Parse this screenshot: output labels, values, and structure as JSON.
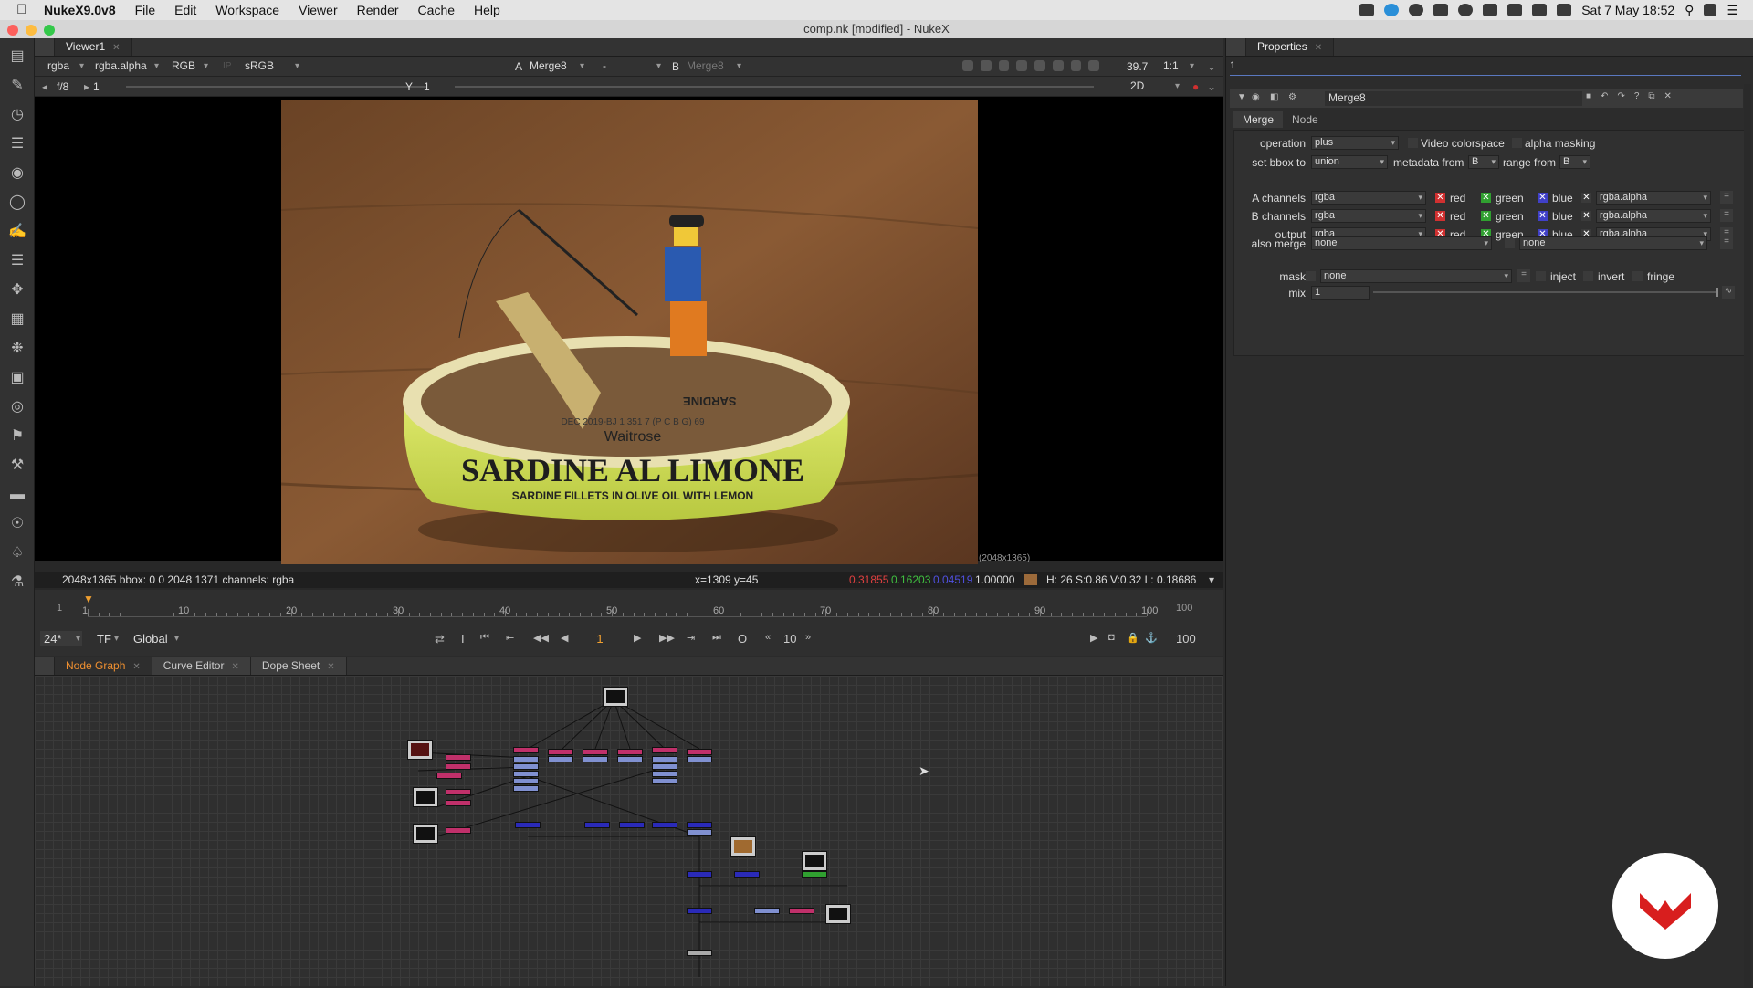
{
  "menubar": {
    "app": "NukeX9.0v8",
    "items": [
      "File",
      "Edit",
      "Workspace",
      "Viewer",
      "Render",
      "Cache",
      "Help"
    ],
    "clock": "Sat 7 May  18:52"
  },
  "window": {
    "title": "comp.nk [modified] - NukeX"
  },
  "viewer": {
    "tab": "Viewer1",
    "controls": {
      "channels": "rgba",
      "alpha": "rgba.alpha",
      "display": "RGB",
      "ip": "IP",
      "lut": "sRGB",
      "a_label": "A",
      "a_input": "Merge8",
      "a_op": "-",
      "b_label": "B",
      "b_input": "Merge8",
      "zoom": "39.7",
      "ratio": "1:1",
      "fstop": "f/8",
      "frame_field": "1",
      "y_label": "Y",
      "y_field": "1",
      "mode": "2D"
    },
    "image": {
      "top_text": "DEC 2019-BJ 1 351 7 (P C B G) 69",
      "brand": "Waitrose",
      "main": "SARDINE AL LIMONE",
      "sub": "SARDINE FILLETS IN OLIVE OIL WITH LEMON",
      "lid_text": "SARDINE",
      "format_label": "(2048x1365)"
    },
    "info": {
      "resolution": "2048x1365  bbox: 0 0 2048 1371 channels: rgba",
      "coords": "x=1309 y=45",
      "r": "0.31855",
      "g": "0.16203",
      "b": "0.04519",
      "a": "1.00000",
      "hsv": "H: 26 S:0.86 V:0.32  L: 0.18686"
    },
    "timeline": {
      "start": "1",
      "ticks": [
        "1",
        "10",
        "20",
        "30",
        "40",
        "50",
        "60",
        "70",
        "80",
        "90",
        "100"
      ],
      "end": "100",
      "fps": "24*",
      "tf": "TF",
      "global": "Global",
      "frame": "1",
      "step": "10",
      "out": "100",
      "i_btn": "I",
      "o_btn": "O"
    }
  },
  "properties": {
    "tab": "Properties",
    "count": "1",
    "node": "Merge8",
    "tabs": [
      "Merge",
      "Node"
    ],
    "operation_label": "operation",
    "operation": "plus",
    "video_colorspace": "Video colorspace",
    "alpha_masking": "alpha masking",
    "bbox_label": "set bbox to",
    "bbox": "union",
    "metadata_label": "metadata from",
    "metadata": "B",
    "range_label": "range from",
    "range": "B",
    "rows": [
      {
        "label": "A channels",
        "value": "rgba",
        "alpha": "rgba.alpha"
      },
      {
        "label": "B channels",
        "value": "rgba",
        "alpha": "rgba.alpha"
      },
      {
        "label": "output",
        "value": "rgba",
        "alpha": "rgba.alpha"
      }
    ],
    "ch": {
      "red": "red",
      "green": "green",
      "blue": "blue"
    },
    "also_merge_label": "also merge",
    "also_merge": "none",
    "also_merge2": "none",
    "mask_label": "mask",
    "mask": "none",
    "inject": "inject",
    "invert": "invert",
    "fringe": "fringe",
    "mix_label": "mix",
    "mix": "1",
    "colors": {
      "red": "#e04040",
      "green": "#40c040",
      "blue": "#5050e0"
    }
  },
  "nodegraph": {
    "tabs": [
      "Node Graph",
      "Curve Editor",
      "Dope Sheet"
    ]
  }
}
